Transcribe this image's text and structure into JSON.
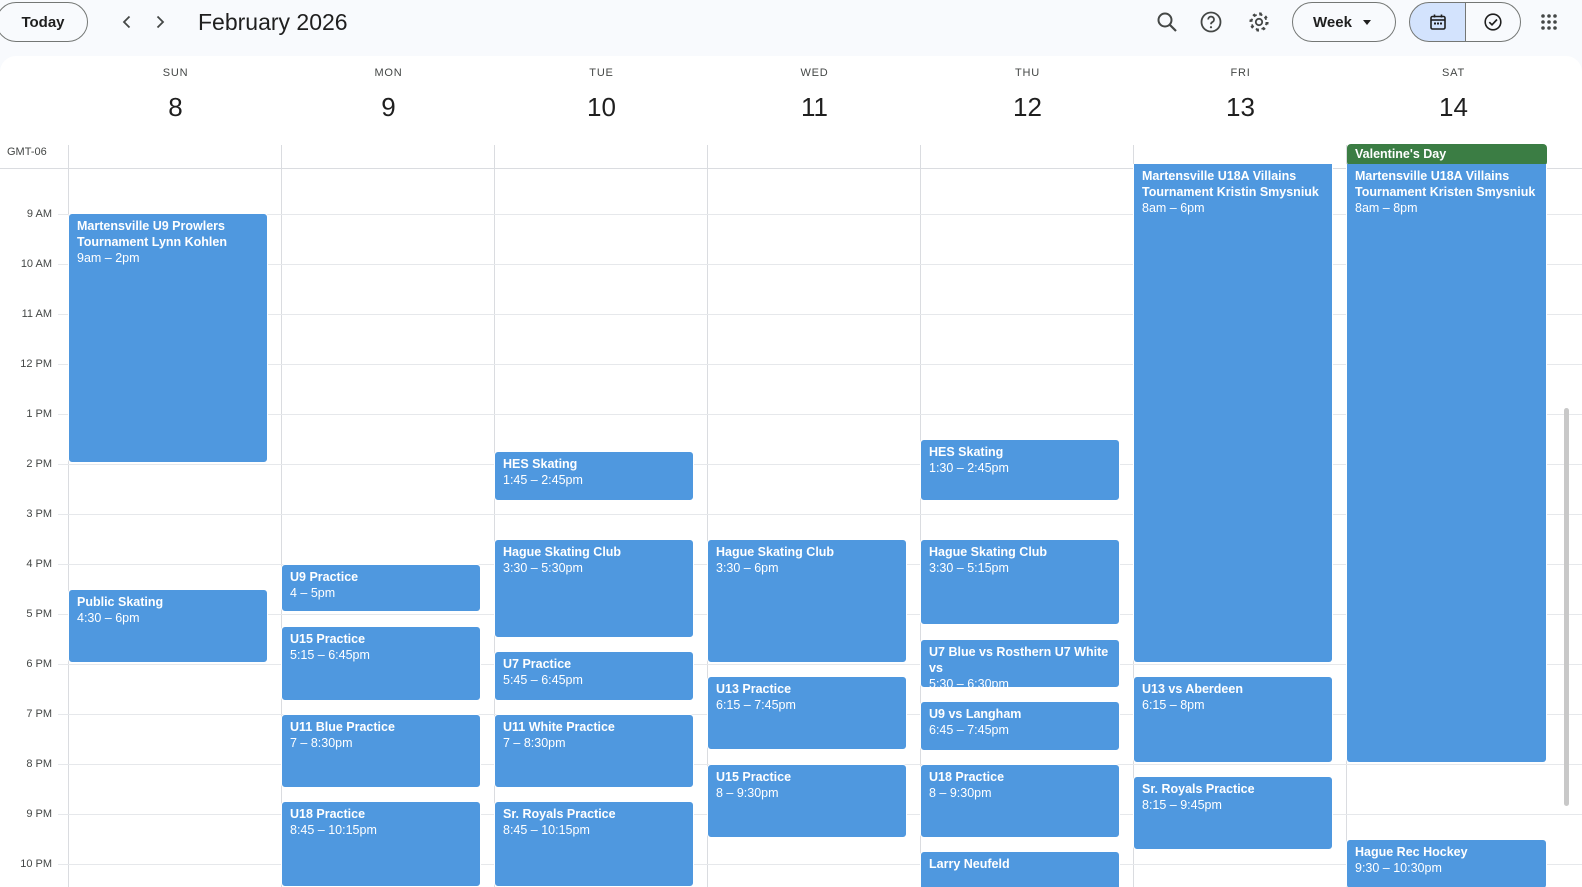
{
  "header": {
    "today_label": "Today",
    "month_title": "February 2026",
    "view_label": "Week",
    "icons": [
      "chevron-left-icon",
      "chevron-right-icon",
      "search-icon",
      "help-icon",
      "gear-icon",
      "calendar-icon",
      "task-check-icon",
      "apps-grid-icon"
    ]
  },
  "timezone": "GMT-06",
  "days": [
    {
      "name": "SUN",
      "date": "8"
    },
    {
      "name": "MON",
      "date": "9"
    },
    {
      "name": "TUE",
      "date": "10"
    },
    {
      "name": "WED",
      "date": "11"
    },
    {
      "name": "THU",
      "date": "12"
    },
    {
      "name": "FRI",
      "date": "13"
    },
    {
      "name": "SAT",
      "date": "14"
    }
  ],
  "time_labels": [
    "9 AM",
    "10 AM",
    "11 AM",
    "12 PM",
    "1 PM",
    "2 PM",
    "3 PM",
    "4 PM",
    "5 PM",
    "6 PM",
    "7 PM",
    "8 PM",
    "9 PM",
    "10 PM"
  ],
  "allday": {
    "title": "Valentine's Day",
    "color": "#3b7d44"
  },
  "event_color": "#4f98df",
  "events": [
    {
      "title": "Martensville U9 Prowlers Tournament Lynn Kohlen",
      "time": "9am – 2pm"
    },
    {
      "title": "Public Skating",
      "time": "4:30 – 6pm"
    },
    {
      "title": "U9 Practice",
      "time": "4 – 5pm"
    },
    {
      "title": "U15 Practice",
      "time": "5:15 – 6:45pm"
    },
    {
      "title": "U11 Blue Practice",
      "time": "7 – 8:30pm"
    },
    {
      "title": "U18 Practice",
      "time": "8:45 – 10:15pm"
    },
    {
      "title": "HES Skating",
      "time": "1:45 – 2:45pm"
    },
    {
      "title": "Hague Skating Club",
      "time": "3:30 – 5:30pm"
    },
    {
      "title": "U7 Practice",
      "time": "5:45 – 6:45pm"
    },
    {
      "title": "U11 White Practice",
      "time": "7 – 8:30pm"
    },
    {
      "title": "Sr. Royals Practice",
      "time": "8:45 – 10:15pm"
    },
    {
      "title": "Hague Skating Club",
      "time": "3:30 – 6pm"
    },
    {
      "title": "U13 Practice",
      "time": "6:15 – 7:45pm"
    },
    {
      "title": "U15 Practice",
      "time": "8 – 9:30pm"
    },
    {
      "title": "HES Skating",
      "time": "1:30 – 2:45pm"
    },
    {
      "title": "Hague Skating Club",
      "time": "3:30 – 5:15pm"
    },
    {
      "title": "U7 Blue vs Rosthern U7 White vs",
      "time": "5:30 – 6:30pm"
    },
    {
      "title": "U9 vs Langham",
      "time": "6:45 – 7:45pm"
    },
    {
      "title": "U18 Practice",
      "time": "8 – 9:30pm"
    },
    {
      "title": "Larry Neufeld",
      "time": ""
    },
    {
      "title": "Martensville U18A Villains Tournament Kristin Smysniuk",
      "time": "8am – 6pm"
    },
    {
      "title": "U13 vs Aberdeen",
      "time": "6:15 – 8pm"
    },
    {
      "title": "Sr. Royals Practice",
      "time": "8:15 – 9:45pm"
    },
    {
      "title": "Martensville U18A Villains Tournament Kristen Smysniuk",
      "time": "8am – 8pm"
    },
    {
      "title": "Hague Rec Hockey",
      "time": "9:30 – 10:30pm"
    }
  ]
}
